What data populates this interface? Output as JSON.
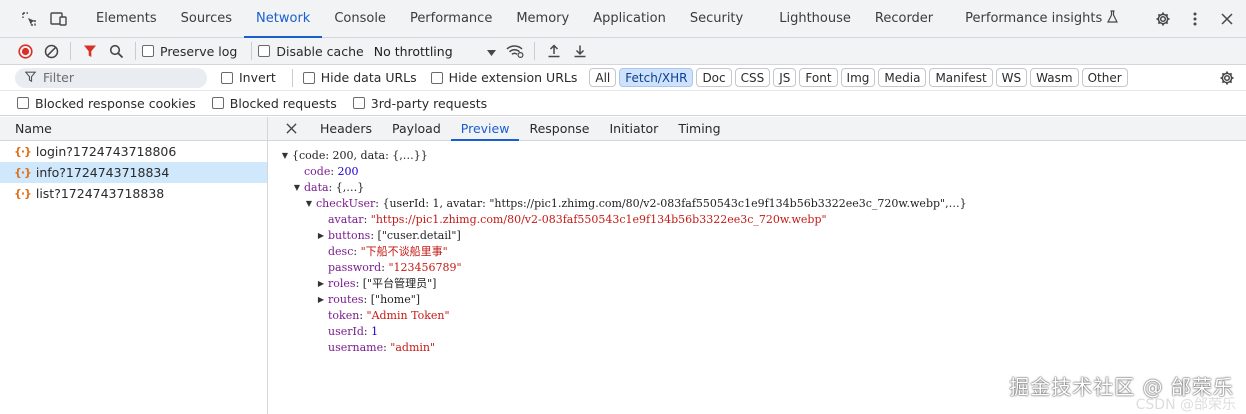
{
  "top_tabs": [
    {
      "label": "Elements"
    },
    {
      "label": "Sources"
    },
    {
      "label": "Network"
    },
    {
      "label": "Console"
    },
    {
      "label": "Performance"
    },
    {
      "label": "Memory"
    },
    {
      "label": "Application"
    },
    {
      "label": "Security"
    },
    {
      "label": "Lighthouse"
    },
    {
      "label": "Recorder"
    },
    {
      "label": "Performance insights"
    }
  ],
  "toolbar": {
    "preserve_log": "Preserve log",
    "disable_cache": "Disable cache",
    "throttling": "No throttling"
  },
  "filter": {
    "placeholder": "Filter",
    "invert": "Invert",
    "hide_data_urls": "Hide data URLs",
    "hide_extension_urls": "Hide extension URLs",
    "types": [
      "All",
      "Fetch/XHR",
      "Doc",
      "CSS",
      "JS",
      "Font",
      "Img",
      "Media",
      "Manifest",
      "WS",
      "Wasm",
      "Other"
    ],
    "active_type": "Fetch/XHR",
    "blocked_cookies": "Blocked response cookies",
    "blocked_requests": "Blocked requests",
    "third_party": "3rd-party requests"
  },
  "requests": {
    "header": "Name",
    "items": [
      {
        "name": "login?1724743718806"
      },
      {
        "name": "info?1724743718834"
      },
      {
        "name": "list?1724743718838"
      }
    ],
    "selected": "info?1724743718834"
  },
  "detail_tabs": [
    "Headers",
    "Payload",
    "Preview",
    "Response",
    "Initiator",
    "Timing"
  ],
  "active_detail_tab": "Preview",
  "preview": {
    "root_summary": "{code: 200, data: {,…}}",
    "code_key": "code",
    "code_val": "200",
    "data_key": "data",
    "data_summary": "{,…}",
    "checkuser_key": "checkUser",
    "checkuser_summary": "{userId: 1, avatar: \"https://pic1.zhimg.com/80/v2-083faf550543c1e9f134b56b3322ee3c_720w.webp\",…}",
    "avatar_key": "avatar",
    "avatar_val": "\"https://pic1.zhimg.com/80/v2-083faf550543c1e9f134b56b3322ee3c_720w.webp\"",
    "buttons_key": "buttons",
    "buttons_val": "[\"cuser.detail\"]",
    "desc_key": "desc",
    "desc_val": "\"下船不谈船里事\"",
    "password_key": "password",
    "password_val": "\"123456789\"",
    "roles_key": "roles",
    "roles_val": "[\"平台管理员\"]",
    "routes_key": "routes",
    "routes_val": "[\"home\"]",
    "token_key": "token",
    "token_val": "\"Admin Token\"",
    "userid_key": "userId",
    "userid_val": "1",
    "username_key": "username",
    "username_val": "\"admin\""
  },
  "watermark": "掘金技术社区 @ 邰荣乐",
  "watermark_faint": "CSDN @邰荣乐"
}
